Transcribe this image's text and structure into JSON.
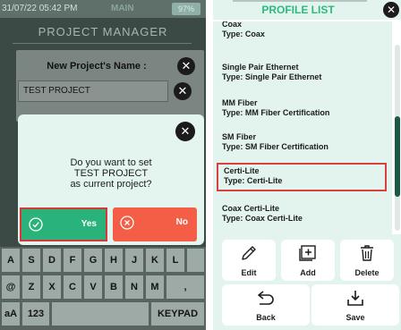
{
  "left": {
    "status": {
      "time": "31/07/22 05:42 PM",
      "mode": "MAIN",
      "battery": "97%"
    },
    "title": "PROJECT MANAGER",
    "name_dialog": {
      "label": "New Project's Name :",
      "value": "TEST PROJECT",
      "close_glyph": "✕",
      "clear_glyph": "✕"
    },
    "confirm": {
      "close_glyph": "✕",
      "line1": "Do you want to set",
      "line2": "TEST PROJECT",
      "line3": "as current project?",
      "yes": "Yes",
      "no": "No"
    },
    "keyboard": {
      "row1": [
        "A",
        "S",
        "D",
        "F",
        "G",
        "H",
        "J",
        "K",
        "L",
        ""
      ],
      "row2": [
        "@",
        "Z",
        "X",
        "C",
        "V",
        "B",
        "N",
        "M",
        ","
      ],
      "row3": [
        "aA",
        "123",
        "",
        "KEYPAD"
      ]
    }
  },
  "right": {
    "title": "PROFILE LIST",
    "close_glyph": "✕",
    "items": [
      {
        "name": "Coax",
        "type": "Type: Coax"
      },
      {
        "name": "Single Pair Ethernet",
        "type": "Type: Single Pair Ethernet"
      },
      {
        "name": "MM Fiber",
        "type": "Type: MM Fiber Certification"
      },
      {
        "name": "SM Fiber",
        "type": "Type: SM Fiber Certification"
      },
      {
        "name": "Certi-Lite",
        "type": "Type: Certi-Lite"
      },
      {
        "name": "Coax Certi-Lite",
        "type": "Type: Coax Certi-Lite"
      }
    ],
    "actions": {
      "edit": "Edit",
      "add": "Add",
      "delete": "Delete",
      "back": "Back",
      "save": "Save"
    }
  },
  "colors": {
    "accent_green": "#2dba7e",
    "yes_green": "#29b37a",
    "no_red": "#f45e47",
    "highlight_red": "#d94141",
    "panel_mint": "#e3f4ee",
    "scroll_thumb": "#1a5a43"
  },
  "icons": [
    "close-icon",
    "clear-icon",
    "check-circle-icon",
    "x-circle-icon",
    "pencil-icon",
    "add-square-icon",
    "trash-icon",
    "back-arrow-icon",
    "download-icon"
  ]
}
